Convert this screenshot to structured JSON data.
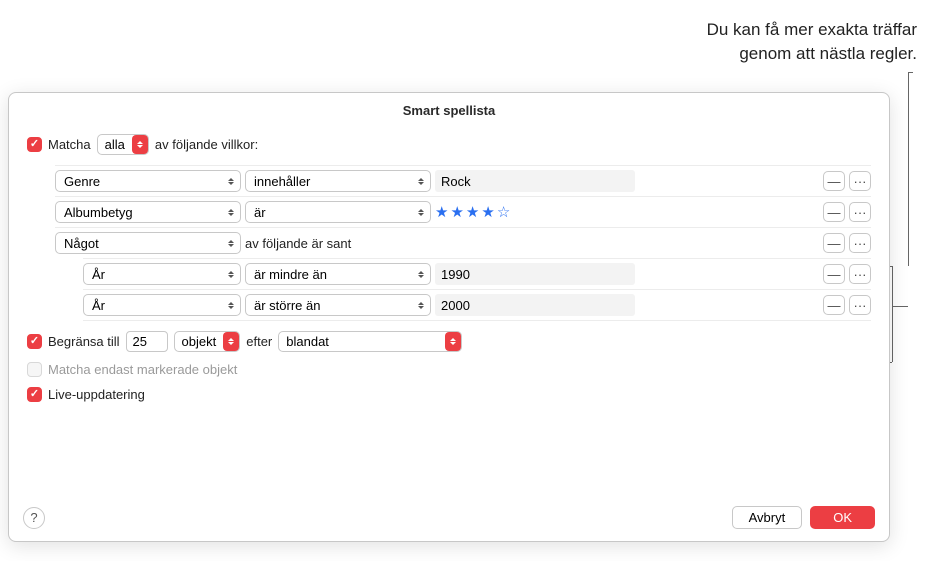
{
  "annotation": {
    "line1": "Du kan få mer exakta träffar",
    "line2": "genom att nästla regler."
  },
  "dialog": {
    "title": "Smart spellista"
  },
  "match": {
    "prefix": "Matcha",
    "mode": "alla",
    "suffix": "av följande villkor:"
  },
  "rules": [
    {
      "field": "Genre",
      "operator": "innehåller",
      "value": "Rock",
      "type": "text"
    },
    {
      "field": "Albumbetyg",
      "operator": "är",
      "value": 4,
      "max": 5,
      "type": "rating"
    },
    {
      "field": "Något",
      "suffix": "av följande är sant",
      "type": "group",
      "children": [
        {
          "field": "År",
          "operator": "är mindre än",
          "value": "1990",
          "type": "text"
        },
        {
          "field": "År",
          "operator": "är större än",
          "value": "2000",
          "type": "text"
        }
      ]
    }
  ],
  "limit": {
    "label": "Begränsa till",
    "value": "25",
    "unit": "objekt",
    "by_label": "efter",
    "by_value": "blandat"
  },
  "checked_only": {
    "label": "Matcha endast markerade objekt"
  },
  "live": {
    "label": "Live-uppdatering"
  },
  "buttons": {
    "cancel": "Avbryt",
    "ok": "OK",
    "remove": "—",
    "more": "···",
    "help": "?"
  }
}
